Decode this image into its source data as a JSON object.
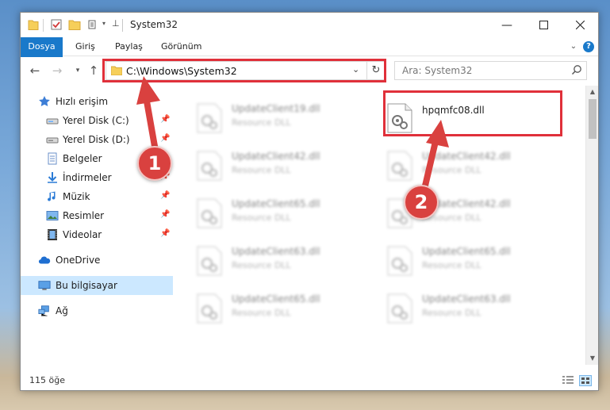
{
  "window": {
    "title": "System32"
  },
  "ribbon": {
    "tabs": [
      {
        "label": "Dosya"
      },
      {
        "label": "Giriş"
      },
      {
        "label": "Paylaş"
      },
      {
        "label": "Görünüm"
      }
    ]
  },
  "address": {
    "path": "C:\\Windows\\System32"
  },
  "search": {
    "placeholder": "Ara: System32"
  },
  "nav": {
    "quick_access": "Hızlı erişim",
    "items": [
      {
        "label": "Yerel Disk (C:)",
        "icon": "drive-icon"
      },
      {
        "label": "Yerel Disk (D:)",
        "icon": "drive-icon"
      },
      {
        "label": "Belgeler",
        "icon": "documents-icon"
      },
      {
        "label": "İndirmeler",
        "icon": "downloads-icon"
      },
      {
        "label": "Müzik",
        "icon": "music-icon"
      },
      {
        "label": "Resimler",
        "icon": "pictures-icon"
      },
      {
        "label": "Videolar",
        "icon": "videos-icon"
      }
    ],
    "onedrive": "OneDrive",
    "this_pc": "Bu bilgisayar",
    "network": "Ağ"
  },
  "files": {
    "highlighted": {
      "name": "hpqmfc08.dll"
    },
    "left_column": [
      {
        "name": "UpdateClient19.dll",
        "type": "Resource DLL"
      },
      {
        "name": "UpdateClient42.dll",
        "type": "Resource DLL"
      },
      {
        "name": "UpdateClient65.dll",
        "type": "Resource DLL"
      },
      {
        "name": "UpdateClient63.dll",
        "type": "Resource DLL"
      },
      {
        "name": "UpdateClient65.dll",
        "type": "Resource DLL"
      }
    ],
    "right_column": [
      {
        "name": "UpdateClient42.dll",
        "type": "Resource DLL"
      },
      {
        "name": "UpdateClient42.dll",
        "type": "Resource DLL"
      },
      {
        "name": "UpdateClient65.dll",
        "type": "Resource DLL"
      },
      {
        "name": "UpdateClient63.dll",
        "type": "Resource DLL"
      }
    ]
  },
  "status": {
    "count": "115 öğe"
  },
  "annotations": {
    "step1": "1",
    "step2": "2",
    "color": "#d9413f"
  }
}
